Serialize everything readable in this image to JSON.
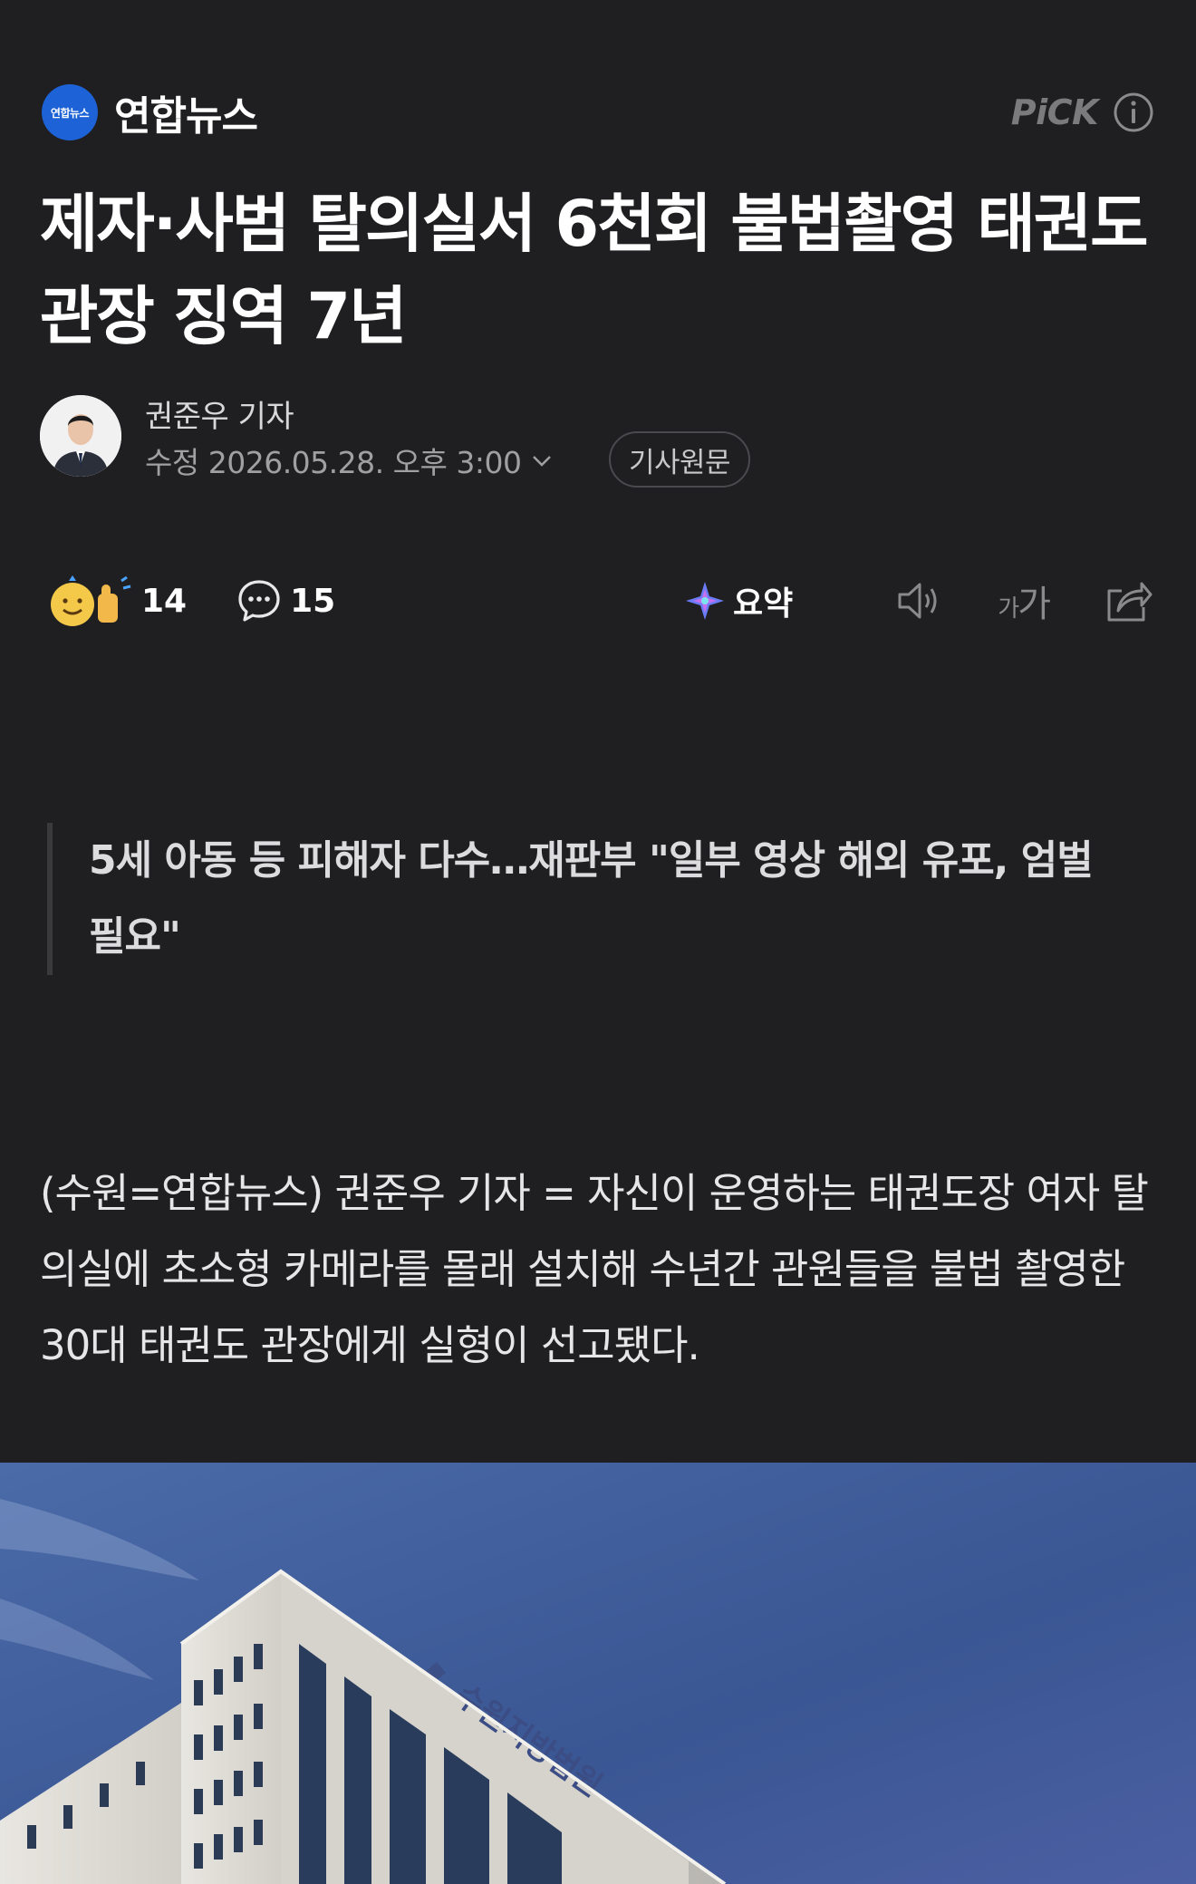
{
  "press": {
    "logo_text": "연합뉴스",
    "name": "연합뉴스",
    "pick_label": "PiCK",
    "info_icon": "info-icon"
  },
  "article": {
    "headline": "제자·사범 탈의실서 6천회 불법촬영 태권도 관장 징역 7년",
    "reporter": "권준우 기자",
    "date": "수정 2026.05.28. 오후 3:00",
    "original_button": "기사원문",
    "subhead": "5세 아동 등 피해자 다수…재판부 \"일부 영상 해외 유포, 엄벌 필요\"",
    "body": "(수원=연합뉴스) 권준우 기자 = 자신이 운영하는 태권도장 여자 탈의실에 초소형 카메라를 몰래 설치해 수년간 관원들을 불법 촬영한 30대 태권도 관장에게 실형이 선고됐다."
  },
  "actions": {
    "reaction_count": "14",
    "comment_count": "15",
    "summary_label": "요약",
    "font_small": "가",
    "font_large": "가",
    "icons": [
      "reaction-emoji-icon",
      "comment-icon",
      "summary-icon",
      "speaker-icon",
      "share-icon"
    ]
  },
  "photo": {
    "building_sign": "수원지방법원"
  },
  "colors": {
    "background": "#1f1f21",
    "press_logo": "#1d62d6",
    "sky": "#3d5a95"
  }
}
